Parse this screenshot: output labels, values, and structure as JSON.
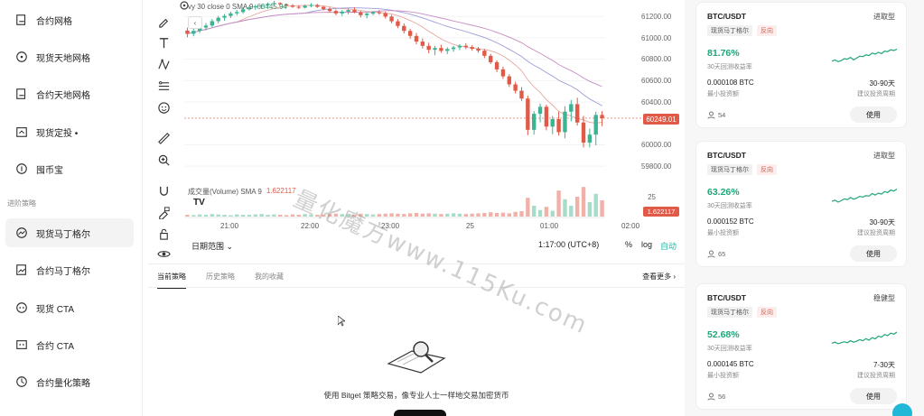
{
  "sidebar": {
    "items": [
      {
        "label": "合约网格",
        "icon": "grid-icon"
      },
      {
        "label": "现货天地网格",
        "icon": "target-icon"
      },
      {
        "label": "合约天地网格",
        "icon": "grid-icon"
      },
      {
        "label": "现货定投 •",
        "icon": "schedule-icon"
      },
      {
        "label": "囤币宝",
        "icon": "coin-icon"
      },
      {
        "label": "现货马丁格尔",
        "icon": "martingale-icon"
      },
      {
        "label": "合约马丁格尔",
        "icon": "martingale-icon"
      },
      {
        "label": "现货 CTA",
        "icon": "cta-icon"
      },
      {
        "label": "合约 CTA",
        "icon": "cta-icon"
      },
      {
        "label": "合约量化策略",
        "icon": "quant-icon"
      }
    ],
    "section_label": "进阶策略",
    "active_index": 5
  },
  "chart": {
    "legend": {
      "text": "vy 30 close 0 SMA 9",
      "value": "60445.94"
    },
    "price_labels": [
      "61200.00",
      "61000.00",
      "60800.00",
      "60600.00",
      "60400.00",
      "60000.00",
      "59800.00"
    ],
    "current_price": "60249.01",
    "volume_legend": {
      "label": "成交量(Volume) SMA 9",
      "value": "1.622117"
    },
    "volume_scale": "25",
    "volume_tag": "1.622117",
    "time_labels": [
      "21:00",
      "22:00",
      "23:00",
      "25",
      "01:00",
      "02:00"
    ],
    "tv_logo": "TV",
    "range_label": "日期范围 ⌄",
    "clock": "1:17:00 (UTC+8)",
    "pct": "%",
    "log": "log",
    "auto": "自动",
    "colors": {
      "up": "#3cb391",
      "down": "#e05a47"
    }
  },
  "chart_data": {
    "type": "candlestick",
    "candles": [
      [
        61068,
        61095,
        61005,
        61038
      ],
      [
        61038,
        61088,
        61015,
        61065
      ],
      [
        61065,
        61120,
        61045,
        61096
      ],
      [
        61096,
        61138,
        61070,
        61115
      ],
      [
        61115,
        61175,
        61100,
        61156
      ],
      [
        61156,
        61205,
        61135,
        61188
      ],
      [
        61188,
        61222,
        61160,
        61205
      ],
      [
        61205,
        61245,
        61185,
        61229
      ],
      [
        61229,
        61260,
        61210,
        61241
      ],
      [
        61241,
        61285,
        61225,
        61267
      ],
      [
        61267,
        61300,
        61255,
        61284
      ],
      [
        61284,
        61310,
        61262,
        61296
      ],
      [
        61296,
        61315,
        61270,
        61305
      ],
      [
        61305,
        61330,
        61285,
        61318
      ],
      [
        61318,
        61345,
        61300,
        61325
      ],
      [
        61325,
        61332,
        61305,
        61314
      ],
      [
        61314,
        61320,
        61295,
        61302
      ],
      [
        61302,
        61315,
        61280,
        61290
      ],
      [
        61290,
        61305,
        61270,
        61282
      ],
      [
        61282,
        61310,
        61275,
        61300
      ],
      [
        61300,
        61325,
        61285,
        61306
      ],
      [
        61306,
        61318,
        61280,
        61290
      ],
      [
        61290,
        61296,
        61255,
        61270
      ],
      [
        61270,
        61285,
        61235,
        61251
      ],
      [
        61251,
        61265,
        61210,
        61228
      ],
      [
        61228,
        61258,
        61205,
        61245
      ],
      [
        61245,
        61275,
        61220,
        61260
      ],
      [
        61260,
        61285,
        61230,
        61239
      ],
      [
        61239,
        61252,
        61190,
        61212
      ],
      [
        61212,
        61240,
        61182,
        61226
      ],
      [
        61226,
        61250,
        61210,
        61241
      ],
      [
        61241,
        61260,
        61215,
        61230
      ],
      [
        61230,
        61245,
        61180,
        61199
      ],
      [
        61199,
        61215,
        61135,
        61155
      ],
      [
        61155,
        61175,
        61090,
        61111
      ],
      [
        61111,
        61135,
        61040,
        61065
      ],
      [
        61065,
        61085,
        60990,
        61018
      ],
      [
        61018,
        61045,
        60940,
        60965
      ],
      [
        60965,
        60995,
        60900,
        60925
      ],
      [
        60925,
        60955,
        60855,
        60888
      ],
      [
        60888,
        60925,
        60840,
        60905
      ],
      [
        60905,
        60935,
        60860,
        60878
      ],
      [
        60878,
        60912,
        60848,
        60895
      ],
      [
        60895,
        60925,
        60870,
        60910
      ],
      [
        60910,
        60940,
        60885,
        60926
      ],
      [
        60926,
        60950,
        60895,
        60914
      ],
      [
        60914,
        60930,
        60880,
        60898
      ],
      [
        60898,
        60915,
        60862,
        60880
      ],
      [
        60880,
        60895,
        60810,
        60832
      ],
      [
        60832,
        60850,
        60755,
        60772
      ],
      [
        60772,
        60790,
        60680,
        60705
      ],
      [
        60705,
        60730,
        60615,
        60640
      ],
      [
        60640,
        60660,
        60540,
        60565
      ],
      [
        60565,
        60590,
        60480,
        60505
      ],
      [
        60505,
        60540,
        60410,
        60432
      ],
      [
        60432,
        60460,
        60090,
        60140
      ],
      [
        60140,
        60315,
        60095,
        60290
      ],
      [
        60290,
        60385,
        60210,
        60355
      ],
      [
        60355,
        60375,
        60135,
        60170
      ],
      [
        60170,
        60270,
        60100,
        60240
      ],
      [
        60240,
        60310,
        60085,
        60118
      ],
      [
        60118,
        60360,
        60060,
        60310
      ],
      [
        60310,
        60420,
        60220,
        60380
      ],
      [
        60380,
        60440,
        60180,
        60208
      ],
      [
        60208,
        60270,
        59975,
        60020
      ],
      [
        60020,
        60150,
        59975,
        60095
      ],
      [
        60095,
        60310,
        59995,
        60279
      ],
      [
        60279,
        60315,
        60175,
        60249
      ]
    ],
    "volumes": [
      0.05,
      0.04,
      0.06,
      0.05,
      0.07,
      0.06,
      0.05,
      0.04,
      0.06,
      0.05,
      0.05,
      0.06,
      0.07,
      0.05,
      0.06,
      0.05,
      0.04,
      0.06,
      0.05,
      0.07,
      0.06,
      0.05,
      0.06,
      0.07,
      0.08,
      0.07,
      0.06,
      0.05,
      0.08,
      0.07,
      0.06,
      0.07,
      0.08,
      0.09,
      0.08,
      0.07,
      0.09,
      0.1,
      0.08,
      0.09,
      0.08,
      0.07,
      0.08,
      0.09,
      0.08,
      0.07,
      0.08,
      0.09,
      0.1,
      0.12,
      0.1,
      0.11,
      0.09,
      0.13,
      0.15,
      0.52,
      0.3,
      0.18,
      0.27,
      0.16,
      0.72,
      0.48,
      0.3,
      0.55,
      0.82,
      0.4,
      0.63,
      0.45
    ],
    "ylim": [
      59700,
      61320
    ],
    "xlabel": "",
    "ylabel": ""
  },
  "panel": {
    "tabs": [
      "当前策略",
      "历史策略",
      "我的收藏"
    ],
    "see_more": "查看更多 ›",
    "empty_text": "使用 Bitget 策略交易，像专业人士一样地交易加密货币"
  },
  "watermark": "量化魔方www.115Ku.com",
  "cards": [
    {
      "pair": "BTC/USDT",
      "risk": "进取型",
      "tags": [
        "现货马丁格尔",
        "反向"
      ],
      "roi": "81.76%",
      "roi_label": "30天回测收益率",
      "min_val": "0.000108 BTC",
      "min_label": "最小投资额",
      "period_val": "30-90天",
      "period_label": "建议投资周期",
      "users": "54",
      "button": "使用",
      "spark": [
        0.4,
        0.45,
        0.38,
        0.42,
        0.5,
        0.48,
        0.55,
        0.45,
        0.52,
        0.6,
        0.58,
        0.65,
        0.62,
        0.72,
        0.68,
        0.75,
        0.7,
        0.8,
        0.78,
        0.85,
        0.82,
        0.88
      ]
    },
    {
      "pair": "BTC/USDT",
      "risk": "进取型",
      "tags": [
        "现货马丁格尔",
        "反向"
      ],
      "roi": "63.26%",
      "roi_label": "30天回测收益率",
      "min_val": "0.000152 BTC",
      "min_label": "最小投资额",
      "period_val": "30-90天",
      "period_label": "建议投资周期",
      "users": "65",
      "button": "使用",
      "spark": [
        0.35,
        0.4,
        0.32,
        0.38,
        0.45,
        0.42,
        0.5,
        0.44,
        0.48,
        0.55,
        0.52,
        0.58,
        0.56,
        0.66,
        0.6,
        0.68,
        0.64,
        0.74,
        0.7,
        0.8,
        0.76,
        0.84
      ]
    },
    {
      "pair": "BTC/USDT",
      "risk": "稳健型",
      "tags": [
        "现货马丁格尔",
        "反向"
      ],
      "roi": "52.68%",
      "roi_label": "30天回测收益率",
      "min_val": "0.000145 BTC",
      "min_label": "最小投资额",
      "period_val": "7-30天",
      "period_label": "建议投资周期",
      "users": "56",
      "button": "使用",
      "spark": [
        0.38,
        0.42,
        0.36,
        0.4,
        0.44,
        0.4,
        0.48,
        0.42,
        0.46,
        0.52,
        0.48,
        0.56,
        0.5,
        0.6,
        0.55,
        0.66,
        0.62,
        0.72,
        0.68,
        0.78,
        0.74,
        0.82
      ]
    }
  ]
}
